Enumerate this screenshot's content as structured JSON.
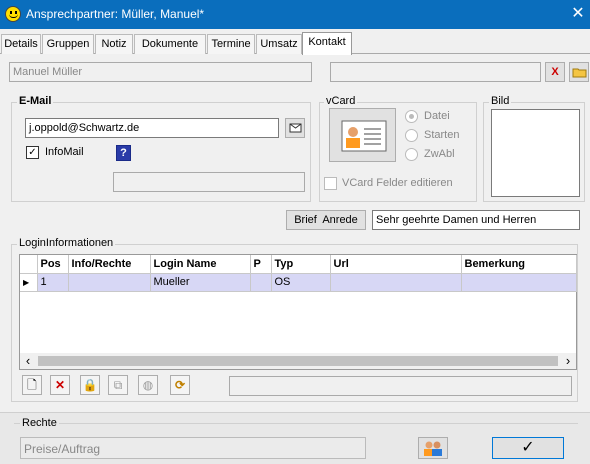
{
  "window": {
    "title": "Ansprechpartner: Müller, Manuel*",
    "close": "✕"
  },
  "tabs": [
    "Details",
    "Gruppen",
    "Notiz",
    "Dokumente",
    "Termine",
    "Umsatz",
    "Kontakt"
  ],
  "contact": {
    "name": "Manuel Müller",
    "delete": "X"
  },
  "email": {
    "group_label": "E-Mail",
    "address": "j.oppold@Schwartz.de",
    "infomail_label": "InfoMail",
    "infomail_checked": "✓",
    "help": "?"
  },
  "vcard": {
    "group_label": "vCard",
    "options": [
      "Datei",
      "Starten",
      "ZwAbl"
    ],
    "edit_fields_label": "VCard Felder editieren"
  },
  "bild": {
    "group_label": "Bild"
  },
  "anrede": {
    "button_label": "Brief  Anrede",
    "value": "Sehr geehrte Damen und Herren"
  },
  "login": {
    "group_label": "LoginInformationen",
    "columns": [
      "Pos",
      "Info/Rechte",
      "Login Name",
      "P",
      "Typ",
      "Url",
      "Bemerkung"
    ],
    "rows": [
      {
        "marker": "▶",
        "pos": "1",
        "info": "",
        "login": "Mueller",
        "p": "",
        "typ": "OS",
        "url": "",
        "bemerkung": ""
      }
    ],
    "scroll_left": "‹",
    "scroll_right": "›"
  },
  "toolbar": {
    "new": "🗋",
    "delete": "✕",
    "lock": "🔒",
    "copy": "⧉",
    "globe": "◍",
    "refresh": "⟳"
  },
  "rechte": {
    "label": "Rechte",
    "value": "Preise/Auftrag"
  },
  "ok": {
    "label": "✓"
  }
}
